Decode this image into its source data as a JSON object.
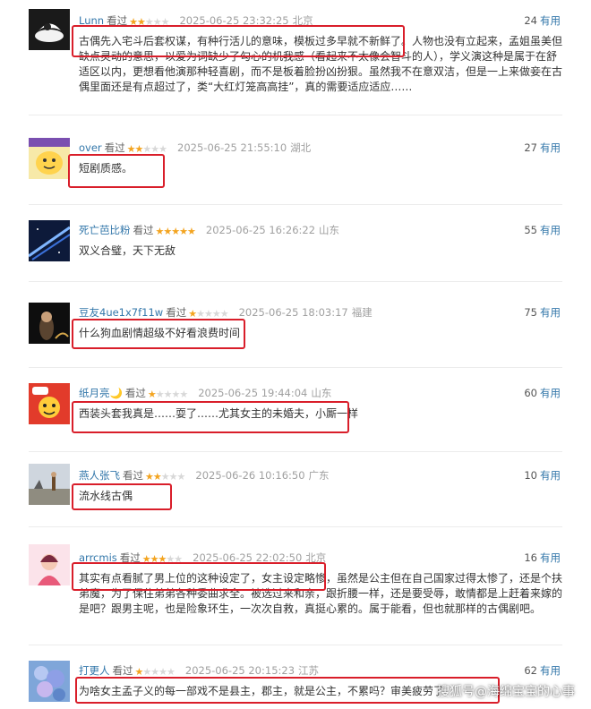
{
  "comments": [
    {
      "user": "Lunn",
      "watched": "看过",
      "stars": 2,
      "time": "2025-06-25 23:32:25",
      "location": "北京",
      "votes": "24",
      "useful": "有用",
      "text": "古偶先入宅斗后套权谋，有种行活儿的意味，模板过多早就不新鲜了。人物也没有立起来，孟姐虽美但缺点灵动的意思，以爱为词缺少了勾心的机我感（看起来不太像会智斗的人），学义演这种是属于在舒适区以内，更想看他演那种轻喜剧，而不是板着脸扮凶扮狠。虽然我不在意双洁，但是一上来做妾在古偶里面还是有点超过了，类“大红灯笼高高挂”，真的需要适应适应……"
    },
    {
      "user": "over",
      "watched": "看过",
      "stars": 2,
      "time": "2025-06-25 21:55:10",
      "location": "湖北",
      "votes": "27",
      "useful": "有用",
      "text": "短剧质感。"
    },
    {
      "user": "死亡芭比粉",
      "watched": "看过",
      "stars": 5,
      "time": "2025-06-25 16:26:22",
      "location": "山东",
      "votes": "55",
      "useful": "有用",
      "text": "双义合璧，天下无敌"
    },
    {
      "user": "豆友4ue1x7f11w",
      "watched": "看过",
      "stars": 1,
      "time": "2025-06-25 18:03:17",
      "location": "福建",
      "votes": "75",
      "useful": "有用",
      "text": "什么狗血剧情超级不好看浪费时间"
    },
    {
      "user": "纸月亮🌙",
      "watched": "看过",
      "stars": 1,
      "time": "2025-06-25 19:44:04",
      "location": "山东",
      "votes": "60",
      "useful": "有用",
      "text": "西装头套我真是……耍了……尤其女主的未婚夫，小厮一样"
    },
    {
      "user": "燕人张飞",
      "watched": "看过",
      "stars": 2,
      "time": "2025-06-26 10:16:50",
      "location": "广东",
      "votes": "10",
      "useful": "有用",
      "text": "流水线古偶"
    },
    {
      "user": "arrcmis",
      "watched": "看过",
      "stars": 3,
      "time": "2025-06-25 22:02:50",
      "location": "北京",
      "votes": "16",
      "useful": "有用",
      "text": "其实有点看腻了男上位的这种设定了，女主设定略惨，虽然是公主但在自己国家过得太惨了，还是个扶弟魔，为了保住弟弟各种委曲求全。被选过来和亲，跟折腰一样，还是要受辱，敢情都是上赶着来嫁的是吧？跟男主呢，也是险象环生，一次次自救，真挺心累的。属于能看，但也就那样的古偶剧吧。"
    },
    {
      "user": "打更人",
      "watched": "看过",
      "stars": 1,
      "time": "2025-06-25 20:15:23",
      "location": "江苏",
      "votes": "62",
      "useful": "有用",
      "text": "为啥女主孟子义的每一部戏不是县主，郡主，就是公主，不累吗？审美疲劳了"
    }
  ],
  "watermark": "搜狐号@海绵宝宝的心事",
  "colors": {
    "highlight": "#d91e2a",
    "star_on": "#f3a420",
    "link": "#3377aa"
  },
  "icons": [
    "avatar",
    "star-icon"
  ]
}
